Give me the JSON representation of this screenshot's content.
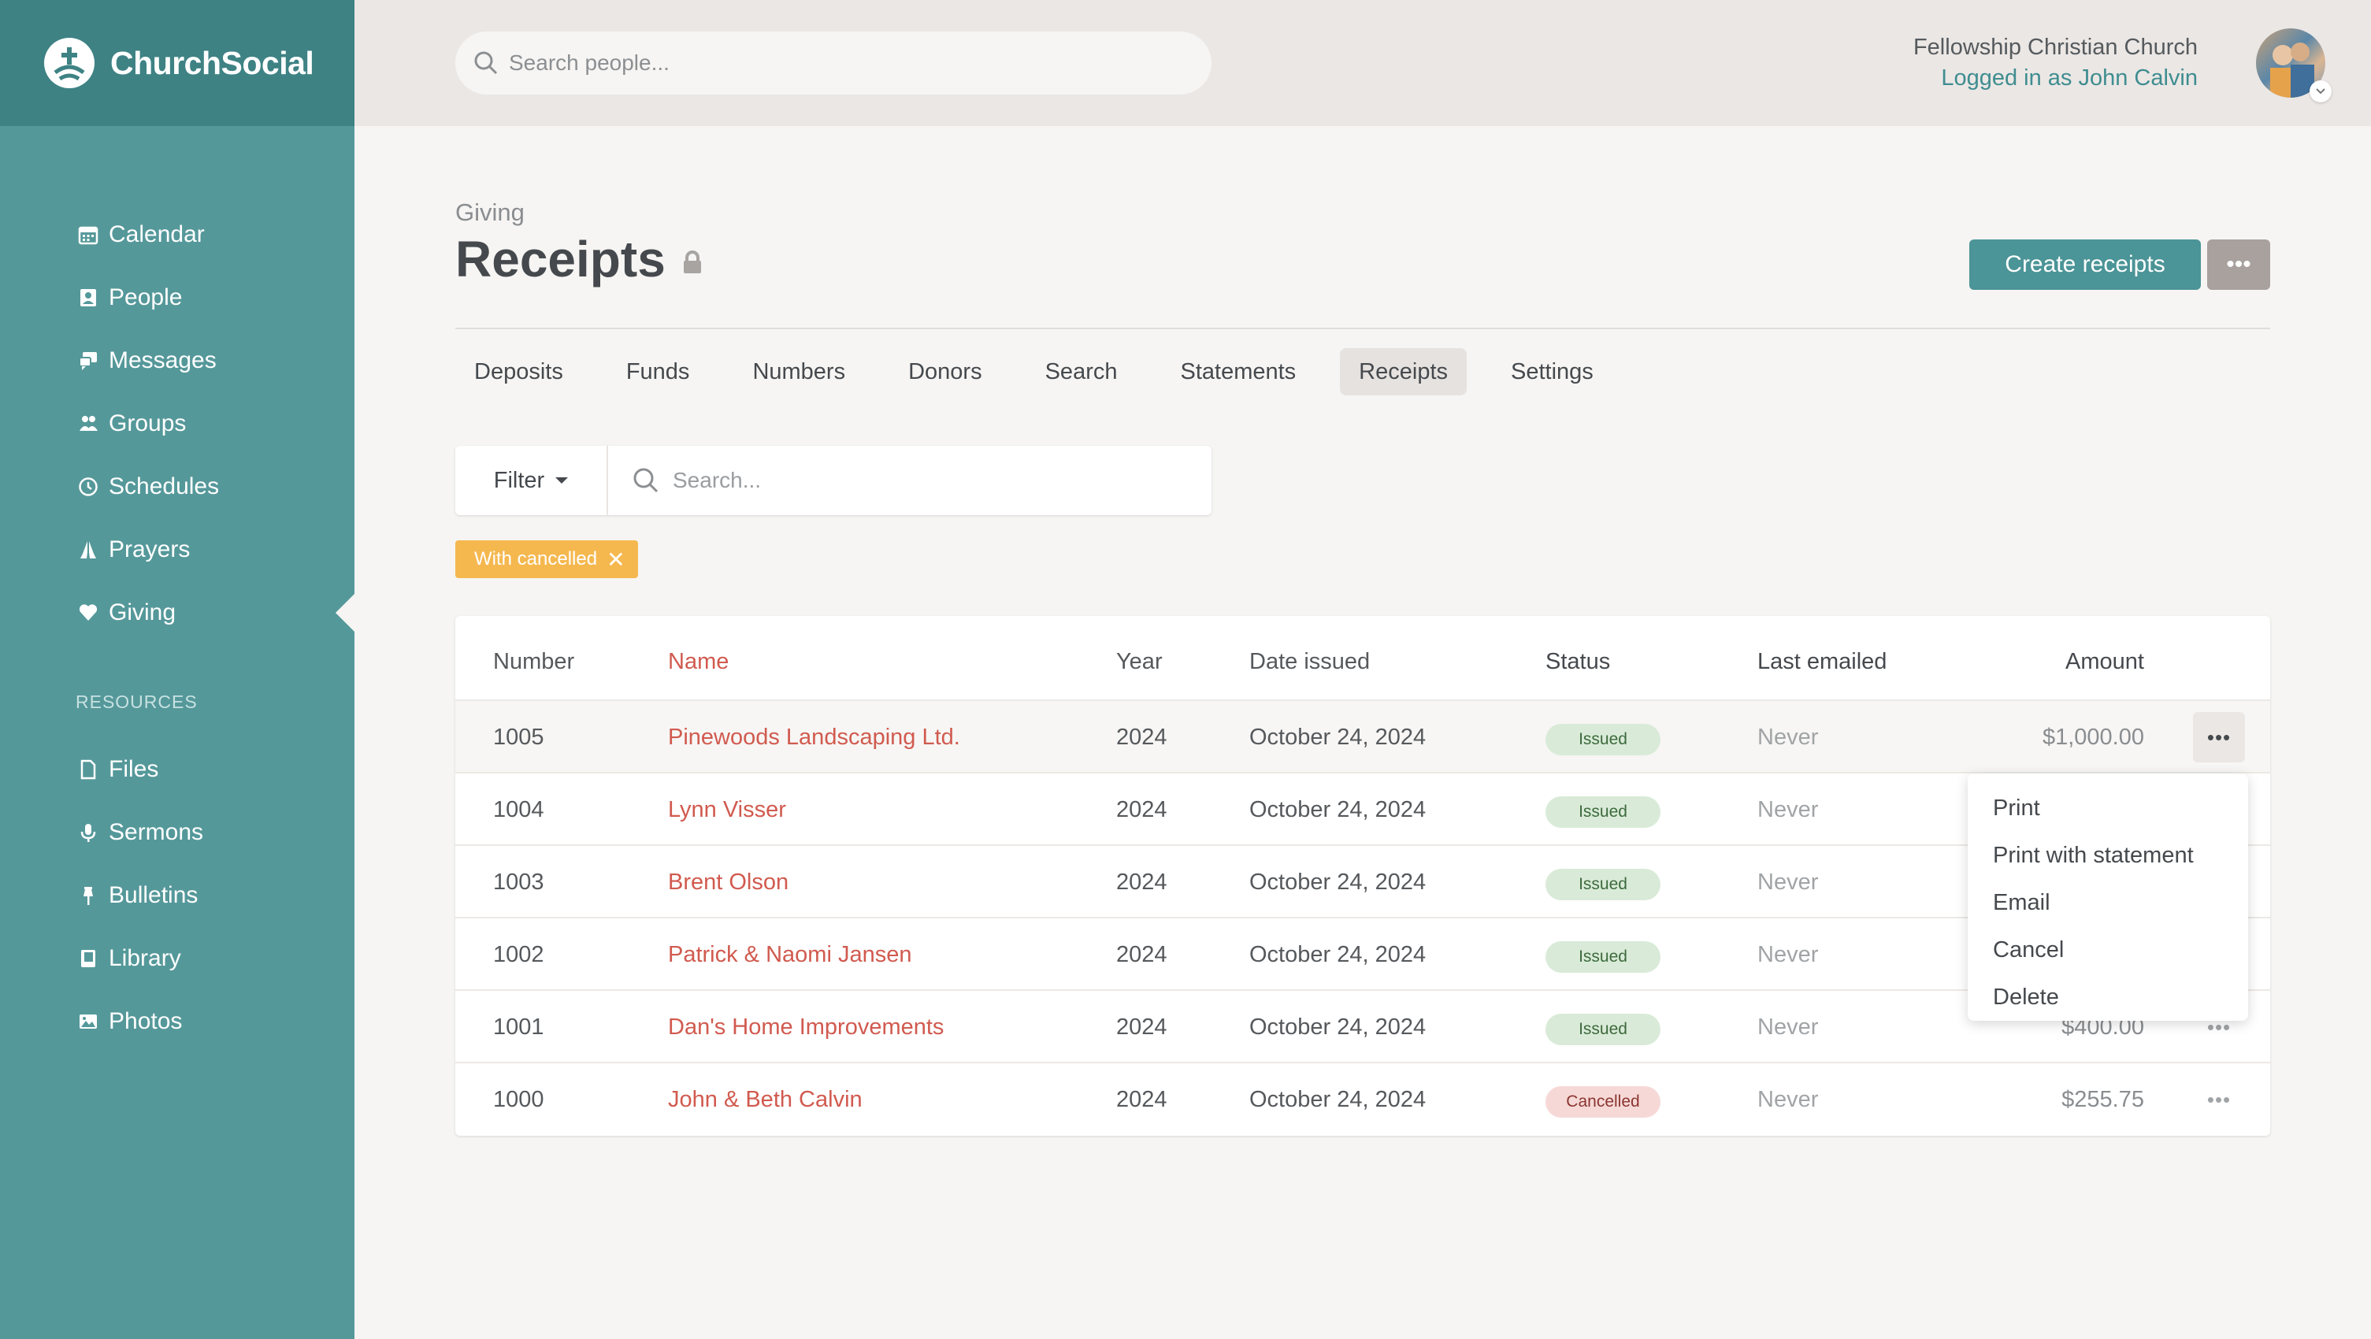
{
  "app": {
    "name": "ChurchSocial",
    "colors": {
      "sidebar": "#55989a",
      "sidebar_logo": "#3e8284",
      "accent": "#4b9497",
      "link": "#d15a4f",
      "chip": "#f5b84f"
    }
  },
  "sidebar": {
    "items": [
      {
        "label": "Calendar",
        "icon": "calendar-icon"
      },
      {
        "label": "People",
        "icon": "people-icon"
      },
      {
        "label": "Messages",
        "icon": "messages-icon"
      },
      {
        "label": "Groups",
        "icon": "groups-icon"
      },
      {
        "label": "Schedules",
        "icon": "clock-icon"
      },
      {
        "label": "Prayers",
        "icon": "praying-hands-icon"
      },
      {
        "label": "Giving",
        "icon": "heart-icon",
        "active": true
      }
    ],
    "resources_label": "RESOURCES",
    "resources": [
      {
        "label": "Files",
        "icon": "file-icon"
      },
      {
        "label": "Sermons",
        "icon": "microphone-icon"
      },
      {
        "label": "Bulletins",
        "icon": "pin-icon"
      },
      {
        "label": "Library",
        "icon": "book-icon"
      },
      {
        "label": "Photos",
        "icon": "image-icon"
      }
    ]
  },
  "topbar": {
    "search_placeholder": "Search people...",
    "church_name": "Fellowship Christian Church",
    "logged_in": "Logged in as John Calvin"
  },
  "header": {
    "breadcrumb": "Giving",
    "title": "Receipts",
    "create_label": "Create receipts",
    "more_label": "•••"
  },
  "tabs": [
    {
      "label": "Deposits"
    },
    {
      "label": "Funds"
    },
    {
      "label": "Numbers"
    },
    {
      "label": "Donors"
    },
    {
      "label": "Search"
    },
    {
      "label": "Statements"
    },
    {
      "label": "Receipts",
      "active": true
    },
    {
      "label": "Settings"
    }
  ],
  "filter": {
    "label": "Filter",
    "search_placeholder": "Search...",
    "chip_label": "With cancelled",
    "chip_close": "✕"
  },
  "table": {
    "columns": [
      "Number",
      "Name",
      "Year",
      "Date issued",
      "Status",
      "Last emailed",
      "Amount"
    ],
    "rows": [
      {
        "number": "1005",
        "name": "Pinewoods Landscaping Ltd.",
        "year": "2024",
        "date": "October 24, 2024",
        "status": "Issued",
        "last": "Never",
        "amount": "$1,000.00"
      },
      {
        "number": "1004",
        "name": "Lynn Visser",
        "year": "2024",
        "date": "October 24, 2024",
        "status": "Issued",
        "last": "Never",
        "amount": ""
      },
      {
        "number": "1003",
        "name": "Brent Olson",
        "year": "2024",
        "date": "October 24, 2024",
        "status": "Issued",
        "last": "Never",
        "amount": ""
      },
      {
        "number": "1002",
        "name": "Patrick & Naomi Jansen",
        "year": "2024",
        "date": "October 24, 2024",
        "status": "Issued",
        "last": "Never",
        "amount": ""
      },
      {
        "number": "1001",
        "name": "Dan's Home Improvements",
        "year": "2024",
        "date": "October 24, 2024",
        "status": "Issued",
        "last": "Never",
        "amount": "$400.00"
      },
      {
        "number": "1000",
        "name": "John & Beth Calvin",
        "year": "2024",
        "date": "October 24, 2024",
        "status": "Cancelled",
        "last": "Never",
        "amount": "$255.75"
      }
    ],
    "row_menu_label": "•••"
  },
  "dropdown": {
    "items": [
      "Print",
      "Print with statement",
      "Email",
      "Cancel",
      "Delete"
    ]
  }
}
